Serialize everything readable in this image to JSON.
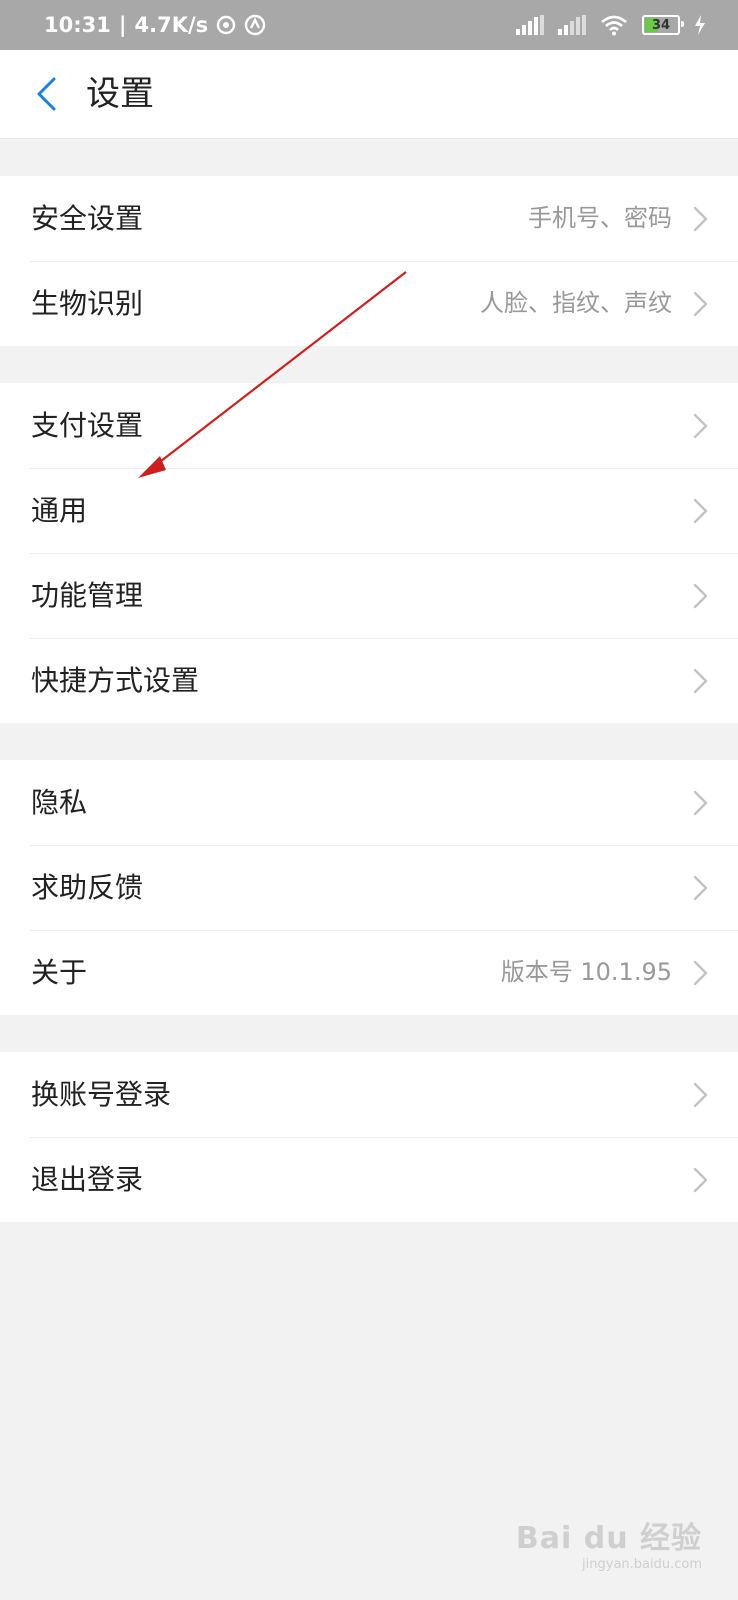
{
  "status_bar": {
    "time": "10:31",
    "speed": "4.7K/s",
    "battery": "34"
  },
  "header": {
    "title": "设置"
  },
  "groups": [
    {
      "rows": [
        {
          "label": "安全设置",
          "value": "手机号、密码"
        },
        {
          "label": "生物识别",
          "value": "人脸、指纹、声纹"
        }
      ]
    },
    {
      "rows": [
        {
          "label": "支付设置",
          "value": ""
        },
        {
          "label": "通用",
          "value": ""
        },
        {
          "label": "功能管理",
          "value": ""
        },
        {
          "label": "快捷方式设置",
          "value": ""
        }
      ]
    },
    {
      "rows": [
        {
          "label": "隐私",
          "value": ""
        },
        {
          "label": "求助反馈",
          "value": ""
        },
        {
          "label": "关于",
          "value": "版本号 10.1.95"
        }
      ]
    },
    {
      "rows": [
        {
          "label": "换账号登录",
          "value": ""
        },
        {
          "label": "退出登录",
          "value": ""
        }
      ]
    }
  ],
  "watermark": {
    "main": "Bai du 经验",
    "sub": "jingyan.baidu.com"
  },
  "colors": {
    "accent": "#1a7fe0",
    "annotation_arrow": "#cc1f1f",
    "background": "#f2f2f2"
  }
}
